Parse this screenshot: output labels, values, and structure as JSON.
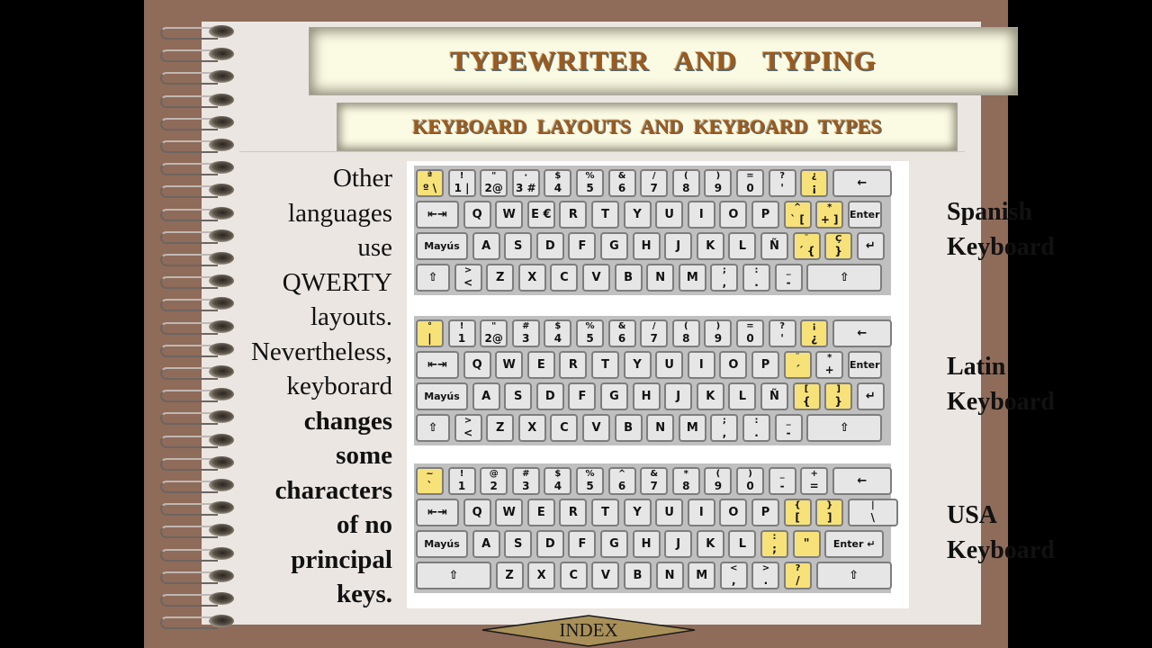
{
  "title": "TYPEWRITER AND TYPING",
  "subtitle": "KEYBOARD LAYOUTS AND KEYBOARD TYPES",
  "body_lines": [
    {
      "text": "Other",
      "bold": false
    },
    {
      "text": "languages",
      "bold": false
    },
    {
      "text": "use",
      "bold": false
    },
    {
      "text": "QWERTY",
      "bold": false
    },
    {
      "text": "layouts.",
      "bold": false
    },
    {
      "text": "Nevertheless,",
      "bold": false
    },
    {
      "text": "keyborard",
      "bold": false
    },
    {
      "text": "changes",
      "bold": true
    },
    {
      "text": "some",
      "bold": true
    },
    {
      "text": "characters",
      "bold": true
    },
    {
      "text": "of no",
      "bold": true
    },
    {
      "text": "principal",
      "bold": true
    },
    {
      "text": "keys.",
      "bold": true
    }
  ],
  "colors": {
    "highlight_key": "#f7e27a",
    "key": "#e6e6e6",
    "title": "#9a5a1f",
    "frame": "#8f6b5a",
    "paper": "#ebe6e2"
  },
  "keyboards": [
    {
      "label_line1": "Spanish",
      "label_line2": "Keyboard",
      "rows": [
        [
          {
            "t": "ª",
            "b": "º \\",
            "w": 27,
            "x": 2,
            "hl": true
          },
          {
            "t": "!",
            "b": "1 |",
            "w": 27
          },
          {
            "t": "\"",
            "b": "2@",
            "w": 27
          },
          {
            "t": "·",
            "b": "3 #",
            "w": 27
          },
          {
            "t": "$",
            "b": "4",
            "w": 27
          },
          {
            "t": "%",
            "b": "5",
            "w": 27
          },
          {
            "t": "&",
            "b": "6",
            "w": 27
          },
          {
            "t": "/",
            "b": "7",
            "w": 27
          },
          {
            "t": "(",
            "b": "8",
            "w": 27
          },
          {
            "t": ")",
            "b": "9",
            "w": 27
          },
          {
            "t": "=",
            "b": "0",
            "w": 27
          },
          {
            "t": "?",
            "b": "'",
            "w": 27
          },
          {
            "t": "¿",
            "b": "¡",
            "w": 27,
            "hl": true
          },
          {
            "c": "←",
            "w": 62
          }
        ],
        [
          {
            "c": "⇤⇥",
            "w": 44,
            "x": 2
          },
          {
            "c": "Q",
            "w": 27
          },
          {
            "c": "W",
            "w": 27
          },
          {
            "c": "E €",
            "w": 27
          },
          {
            "c": "R",
            "w": 27
          },
          {
            "c": "T",
            "w": 27
          },
          {
            "c": "Y",
            "w": 27
          },
          {
            "c": "U",
            "w": 27
          },
          {
            "c": "I",
            "w": 27
          },
          {
            "c": "O",
            "w": 27
          },
          {
            "c": "P",
            "w": 27
          },
          {
            "t": "^",
            "b": "` [",
            "w": 27,
            "hl": true
          },
          {
            "t": "*",
            "b": "+ ]",
            "w": 27,
            "hl": true
          },
          {
            "c": "Enter",
            "w": 34,
            "small": true
          }
        ],
        [
          {
            "c": "Mayús",
            "w": 54,
            "x": 2,
            "small": true
          },
          {
            "c": "A",
            "w": 27
          },
          {
            "c": "S",
            "w": 27
          },
          {
            "c": "D",
            "w": 27
          },
          {
            "c": "F",
            "w": 27
          },
          {
            "c": "G",
            "w": 27
          },
          {
            "c": "H",
            "w": 27
          },
          {
            "c": "J",
            "w": 27
          },
          {
            "c": "K",
            "w": 27
          },
          {
            "c": "L",
            "w": 27
          },
          {
            "c": "Ñ",
            "w": 27
          },
          {
            "t": "¨",
            "b": "´ {",
            "w": 27,
            "hl": true
          },
          {
            "t": "Ç",
            "b": "}",
            "w": 27,
            "hl": true
          },
          {
            "c": "↵",
            "w": 27
          }
        ],
        [
          {
            "c": "⇧",
            "w": 34,
            "x": 2
          },
          {
            "t": ">",
            "b": "<",
            "w": 27
          },
          {
            "c": "Z",
            "w": 27
          },
          {
            "c": "X",
            "w": 27
          },
          {
            "c": "C",
            "w": 27
          },
          {
            "c": "V",
            "w": 27
          },
          {
            "c": "B",
            "w": 27
          },
          {
            "c": "N",
            "w": 27
          },
          {
            "c": "M",
            "w": 27
          },
          {
            "t": ";",
            "b": ",",
            "w": 27
          },
          {
            "t": ":",
            "b": ".",
            "w": 27
          },
          {
            "t": "_",
            "b": "-",
            "w": 27
          },
          {
            "c": "⇧",
            "w": 80
          }
        ]
      ]
    },
    {
      "label_line1": "Latin",
      "label_line2": "Keyboard",
      "rows": [
        [
          {
            "t": "°",
            "b": "|",
            "w": 27,
            "x": 2,
            "hl": true
          },
          {
            "t": "!",
            "b": "1",
            "w": 27
          },
          {
            "t": "\"",
            "b": "2@",
            "w": 27
          },
          {
            "t": "#",
            "b": "3",
            "w": 27
          },
          {
            "t": "$",
            "b": "4",
            "w": 27
          },
          {
            "t": "%",
            "b": "5",
            "w": 27
          },
          {
            "t": "&",
            "b": "6",
            "w": 27
          },
          {
            "t": "/",
            "b": "7",
            "w": 27
          },
          {
            "t": "(",
            "b": "8",
            "w": 27
          },
          {
            "t": ")",
            "b": "9",
            "w": 27
          },
          {
            "t": "=",
            "b": "0",
            "w": 27
          },
          {
            "t": "?",
            "b": "'",
            "w": 27
          },
          {
            "t": "¡",
            "b": "¿",
            "w": 27,
            "hl": true
          },
          {
            "c": "←",
            "w": 62
          }
        ],
        [
          {
            "c": "⇤⇥",
            "w": 44,
            "x": 2
          },
          {
            "c": "Q",
            "w": 27
          },
          {
            "c": "W",
            "w": 27
          },
          {
            "c": "E",
            "w": 27
          },
          {
            "c": "R",
            "w": 27
          },
          {
            "c": "T",
            "w": 27
          },
          {
            "c": "Y",
            "w": 27
          },
          {
            "c": "U",
            "w": 27
          },
          {
            "c": "I",
            "w": 27
          },
          {
            "c": "O",
            "w": 27
          },
          {
            "c": "P",
            "w": 27
          },
          {
            "t": "¨",
            "b": "´",
            "w": 27,
            "hl": true
          },
          {
            "t": "*",
            "b": "+",
            "w": 27
          },
          {
            "c": "Enter",
            "w": 34,
            "small": true
          }
        ],
        [
          {
            "c": "Mayús",
            "w": 54,
            "x": 2,
            "small": true
          },
          {
            "c": "A",
            "w": 27
          },
          {
            "c": "S",
            "w": 27
          },
          {
            "c": "D",
            "w": 27
          },
          {
            "c": "F",
            "w": 27
          },
          {
            "c": "G",
            "w": 27
          },
          {
            "c": "H",
            "w": 27
          },
          {
            "c": "J",
            "w": 27
          },
          {
            "c": "K",
            "w": 27
          },
          {
            "c": "L",
            "w": 27
          },
          {
            "c": "Ñ",
            "w": 27
          },
          {
            "t": "[",
            "b": "{",
            "w": 27,
            "hl": true
          },
          {
            "t": "]",
            "b": "}",
            "w": 27,
            "hl": true
          },
          {
            "c": "↵",
            "w": 27
          }
        ],
        [
          {
            "c": "⇧",
            "w": 34,
            "x": 2
          },
          {
            "t": ">",
            "b": "<",
            "w": 27
          },
          {
            "c": "Z",
            "w": 27
          },
          {
            "c": "X",
            "w": 27
          },
          {
            "c": "C",
            "w": 27
          },
          {
            "c": "V",
            "w": 27
          },
          {
            "c": "B",
            "w": 27
          },
          {
            "c": "N",
            "w": 27
          },
          {
            "c": "M",
            "w": 27
          },
          {
            "t": ";",
            "b": ",",
            "w": 27
          },
          {
            "t": ":",
            "b": ".",
            "w": 27
          },
          {
            "t": "_",
            "b": "-",
            "w": 27
          },
          {
            "c": "⇧",
            "w": 80
          }
        ]
      ]
    },
    {
      "label_line1": "USA",
      "label_line2": "Keyboard",
      "rows": [
        [
          {
            "t": "~",
            "b": "`",
            "w": 27,
            "x": 2,
            "hl": true
          },
          {
            "t": "!",
            "b": "1",
            "w": 27
          },
          {
            "t": "@",
            "b": "2",
            "w": 27
          },
          {
            "t": "#",
            "b": "3",
            "w": 27
          },
          {
            "t": "$",
            "b": "4",
            "w": 27
          },
          {
            "t": "%",
            "b": "5",
            "w": 27
          },
          {
            "t": "^",
            "b": "6",
            "w": 27
          },
          {
            "t": "&",
            "b": "7",
            "w": 27
          },
          {
            "t": "*",
            "b": "8",
            "w": 27
          },
          {
            "t": "(",
            "b": "9",
            "w": 27
          },
          {
            "t": ")",
            "b": "0",
            "w": 27
          },
          {
            "t": "_",
            "b": "-",
            "w": 27
          },
          {
            "t": "+",
            "b": "=",
            "w": 27
          },
          {
            "c": "←",
            "w": 62
          }
        ],
        [
          {
            "c": "⇤⇥",
            "w": 44,
            "x": 2
          },
          {
            "c": "Q",
            "w": 27
          },
          {
            "c": "W",
            "w": 27
          },
          {
            "c": "E",
            "w": 27
          },
          {
            "c": "R",
            "w": 27
          },
          {
            "c": "T",
            "w": 27
          },
          {
            "c": "Y",
            "w": 27
          },
          {
            "c": "U",
            "w": 27
          },
          {
            "c": "I",
            "w": 27
          },
          {
            "c": "O",
            "w": 27
          },
          {
            "c": "P",
            "w": 27
          },
          {
            "t": "{",
            "b": "[",
            "w": 27,
            "hl": true
          },
          {
            "t": "}",
            "b": "]",
            "w": 27,
            "hl": true
          },
          {
            "t": "|",
            "b": "\\",
            "w": 52
          }
        ],
        [
          {
            "c": "Mayús",
            "w": 54,
            "x": 2,
            "small": true
          },
          {
            "c": "A",
            "w": 27
          },
          {
            "c": "S",
            "w": 27
          },
          {
            "c": "D",
            "w": 27
          },
          {
            "c": "F",
            "w": 27
          },
          {
            "c": "G",
            "w": 27
          },
          {
            "c": "H",
            "w": 27
          },
          {
            "c": "J",
            "w": 27
          },
          {
            "c": "K",
            "w": 27
          },
          {
            "c": "L",
            "w": 27
          },
          {
            "t": ":",
            "b": ";",
            "w": 27,
            "hl": true
          },
          {
            "c": "\"",
            "w": 27,
            "hl": true
          },
          {
            "c": "Enter ↵",
            "w": 62,
            "small": true
          }
        ],
        [
          {
            "c": "⇧",
            "w": 80,
            "x": 2
          },
          {
            "c": "Z",
            "w": 27
          },
          {
            "c": "X",
            "w": 27
          },
          {
            "c": "C",
            "w": 27
          },
          {
            "c": "V",
            "w": 27
          },
          {
            "c": "B",
            "w": 27
          },
          {
            "c": "N",
            "w": 27
          },
          {
            "c": "M",
            "w": 27
          },
          {
            "t": "<",
            "b": ",",
            "w": 27
          },
          {
            "t": ">",
            "b": ".",
            "w": 27
          },
          {
            "t": "?",
            "b": "/",
            "w": 27,
            "hl": true
          },
          {
            "c": "⇧",
            "w": 80
          }
        ]
      ]
    }
  ],
  "index_button": "INDEX"
}
